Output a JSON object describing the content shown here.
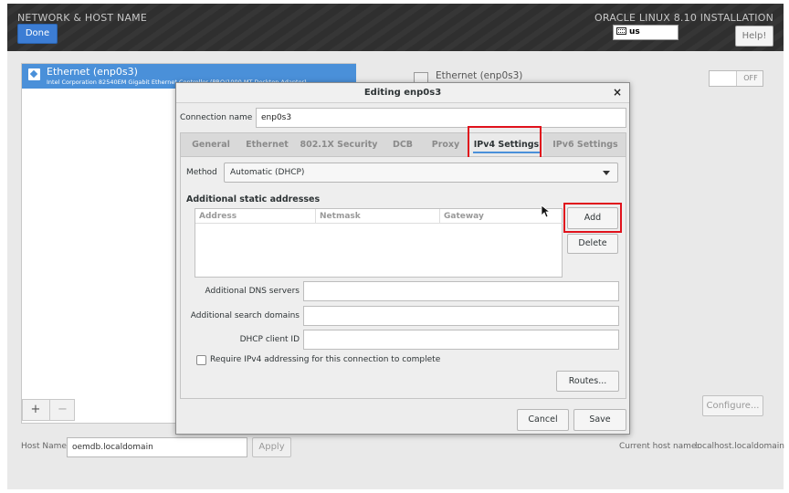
{
  "header": {
    "title": "NETWORK & HOST NAME",
    "brand": "ORACLE LINUX 8.10 INSTALLATION",
    "done_label": "Done",
    "keyboard_layout": "us",
    "help_label": "Help!"
  },
  "devices": {
    "items": [
      {
        "name": "Ethernet (enp0s3)",
        "description": "Intel Corporation 82540EM Gigabit Ethernet Controller (PRO/1000 MT Desktop Adapter)"
      }
    ],
    "add_label": "+",
    "remove_label": "−"
  },
  "device_detail": {
    "title": "Ethernet (enp0s3)",
    "toggle_state": "OFF",
    "configure_label": "Configure..."
  },
  "hostname": {
    "label": "Host Name:",
    "value": "oemdb.localdomain",
    "apply_label": "Apply",
    "current_label": "Current host name:",
    "current_value": "localhost.localdomain"
  },
  "dialog": {
    "title": "Editing enp0s3",
    "close_label": "×",
    "connection_name_label": "Connection name",
    "connection_name_value": "enp0s3",
    "tabs": [
      {
        "label": "General"
      },
      {
        "label": "Ethernet"
      },
      {
        "label": "802.1X Security"
      },
      {
        "label": "DCB"
      },
      {
        "label": "Proxy"
      },
      {
        "label": "IPv4 Settings"
      },
      {
        "label": "IPv6 Settings"
      }
    ],
    "active_tab": "IPv4 Settings",
    "method_label": "Method",
    "method_value": "Automatic (DHCP)",
    "addresses_heading": "Additional static addresses",
    "address_columns": [
      "Address",
      "Netmask",
      "Gateway"
    ],
    "add_label": "Add",
    "delete_label": "Delete",
    "dns_label": "Additional DNS servers",
    "dns_value": "",
    "search_label": "Additional search domains",
    "search_value": "",
    "dhcp_label": "DHCP client ID",
    "dhcp_value": "",
    "require_ipv4_label": "Require IPv4 addressing for this connection to complete",
    "require_ipv4_checked": false,
    "routes_label": "Routes...",
    "cancel_label": "Cancel",
    "save_label": "Save"
  },
  "colors": {
    "accent": "#4a90d9",
    "done_button": "#3c7dd4",
    "highlight_box": "#e0121c",
    "header_bg": "#2f2f2f"
  }
}
